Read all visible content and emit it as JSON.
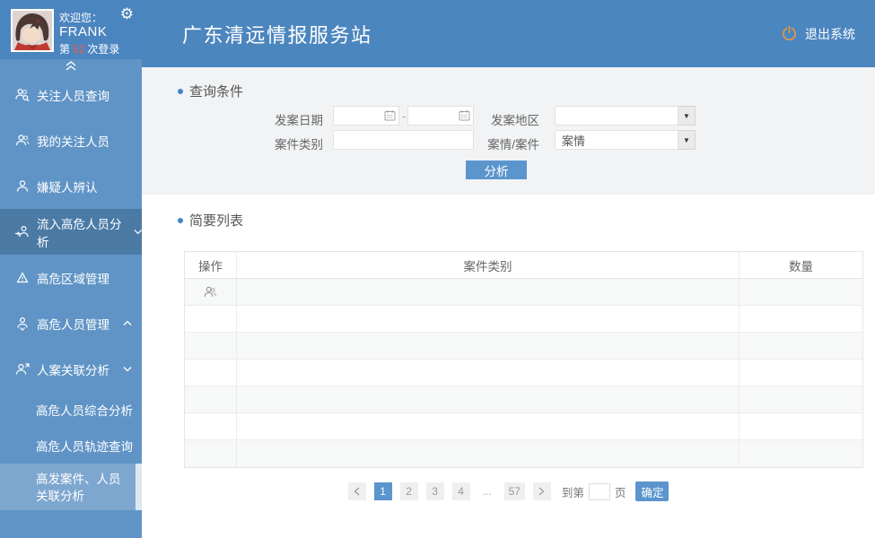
{
  "colors": {
    "header_blue": "#4c86bf",
    "sidebar_blue": "#6094c6",
    "sidebar_active_item": "#4b7aa5",
    "sidebar_selected_sub": "#7ea7d0",
    "accent_button_blue": "#5b95ce",
    "logout_orange": "#e89a3f",
    "login_count_red": "#f45b43",
    "query_section_bg": "#f1f3f5",
    "table_alt_row": "#f7f8f8"
  },
  "icons": {
    "gear_glyph": "⚙",
    "settings": "gear-icon",
    "collapse": "double-chevron-up-icon",
    "logout": "power-icon",
    "menu": [
      "people-search-icon",
      "person-group-icon",
      "person-icon",
      "person-flow-in-icon",
      "warning-triangle-icon",
      "person-badge-icon",
      "person-link-icon"
    ],
    "calendar": "calendar-icon",
    "dropdown_caret": "▼",
    "row_action": "people-icon"
  },
  "profile": {
    "welcome": "欢迎您：",
    "username": "FRANK",
    "login_prefix": "第",
    "login_count": "52",
    "login_suffix": "次登录"
  },
  "header": {
    "title": "广东清远情报服务站",
    "logout": "退出系统"
  },
  "sidebar": {
    "items": [
      {
        "label": "关注人员查询"
      },
      {
        "label": "我的关注人员"
      },
      {
        "label": "嫌疑人辨认"
      },
      {
        "label": "流入高危人员分析",
        "active": true,
        "chevron": "down"
      },
      {
        "label": "高危区域管理"
      },
      {
        "label": "高危人员管理",
        "chevron": "up"
      },
      {
        "label": "人案关联分析",
        "chevron": "down"
      }
    ],
    "subitems": [
      {
        "label": "高危人员综合分析"
      },
      {
        "label": "高危人员轨迹查询"
      },
      {
        "label": "高发案件、人员关联分析",
        "selected": true
      }
    ]
  },
  "query": {
    "title": "查询条件",
    "date_label": "发案日期",
    "date_separator": "-",
    "region_label": "发案地区",
    "category_label": "案件类别",
    "case_label": "案情/案件",
    "case_value": "案情",
    "analyze_label": "分析"
  },
  "list": {
    "title": "简要列表",
    "columns": [
      "操作",
      "案件类别",
      "数量"
    ],
    "row_count": 7
  },
  "pagination": {
    "pages": [
      "1",
      "2",
      "3",
      "4"
    ],
    "active_page": "1",
    "ellipsis": "...",
    "last_page": "57",
    "goto_prefix": "到第",
    "goto_suffix": "页",
    "confirm_label": "确定"
  }
}
